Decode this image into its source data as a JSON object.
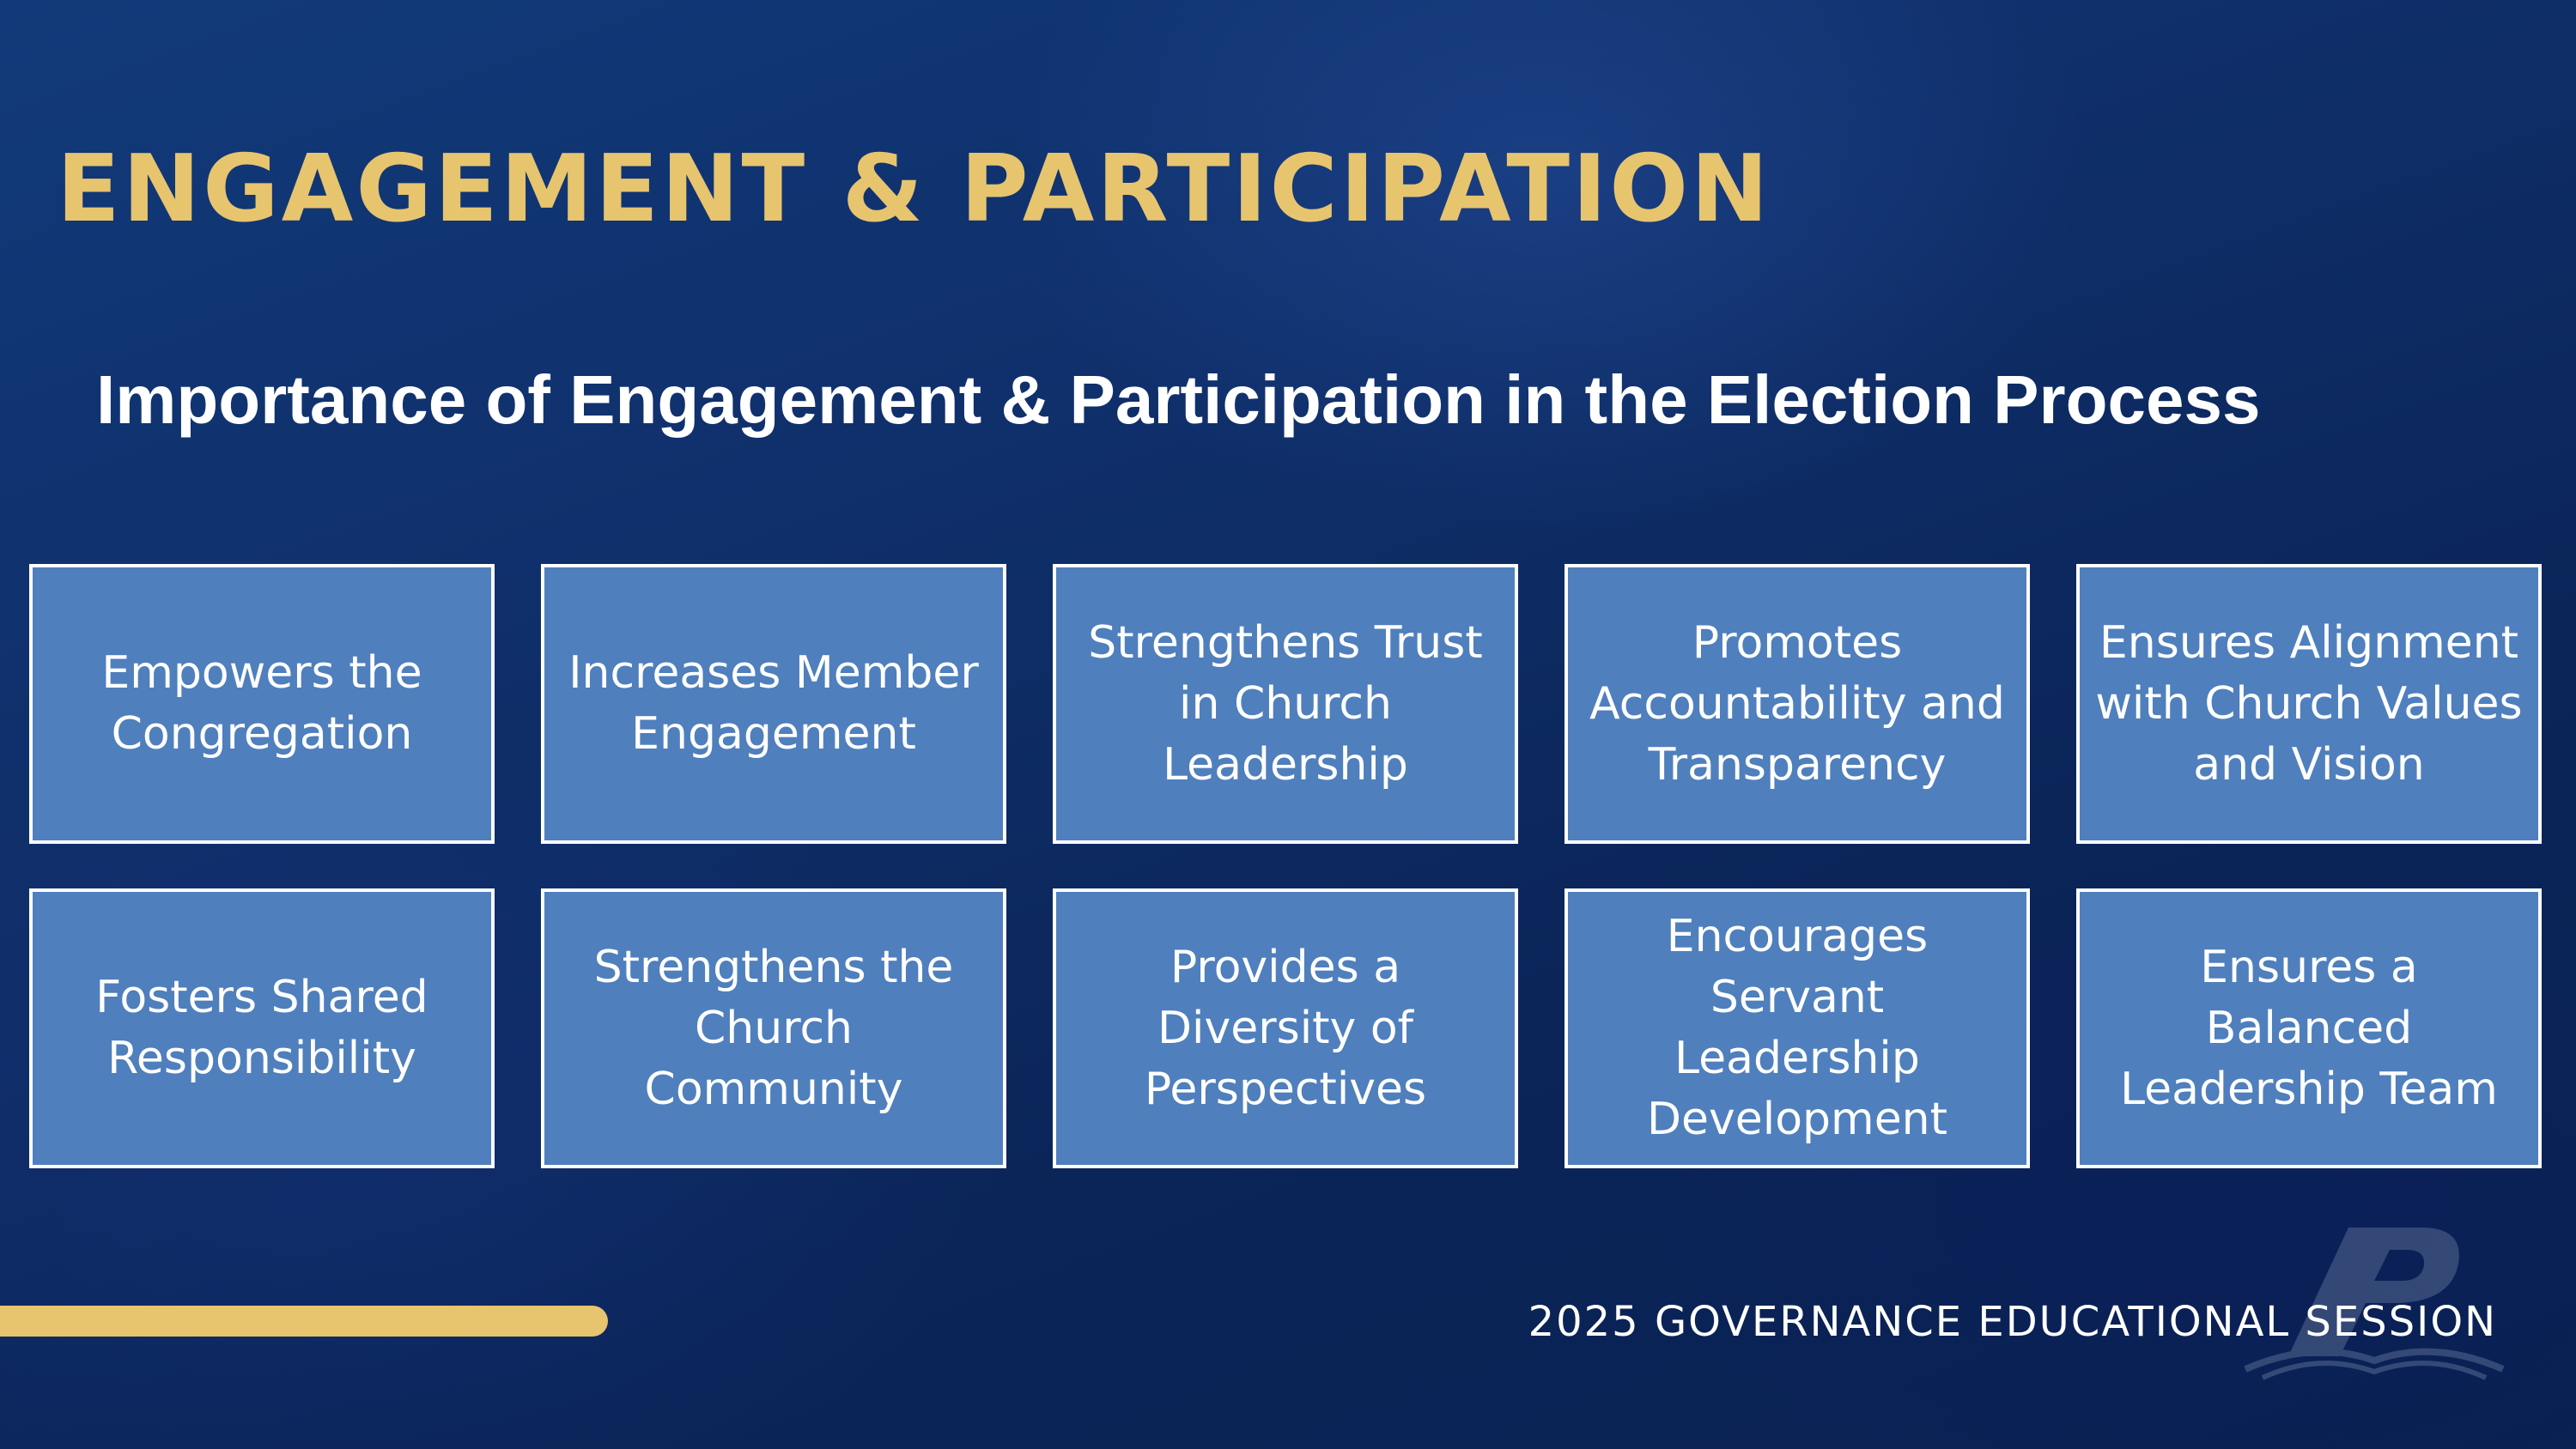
{
  "slide": {
    "title": "ENGAGEMENT & PARTICIPATION",
    "subtitle": "Importance of Engagement & Participation in the Election Process",
    "boxes": [
      {
        "label": "Empowers the Congregation"
      },
      {
        "label": "Increases Member Engagement"
      },
      {
        "label": "Strengthens Trust in Church Leadership"
      },
      {
        "label": "Promotes Accountability and Transparency"
      },
      {
        "label": "Ensures Alignment with Church Values and Vision"
      },
      {
        "label": "Fosters Shared Responsibility"
      },
      {
        "label": "Strengthens the Church Community"
      },
      {
        "label": "Provides a Diversity of Perspectives"
      },
      {
        "label": "Encourages Servant Leadership Development"
      },
      {
        "label": "Ensures a Balanced Leadership Team"
      }
    ],
    "footer": "2025 GOVERNANCE EDUCATIONAL SESSION"
  },
  "colors": {
    "title_gold": "#e7c46e",
    "box_fill": "#4f7fbd",
    "box_border": "#ffffff",
    "background_navy": "#0f2f6a"
  },
  "icons": {
    "watermark": "p-logo-icon"
  }
}
